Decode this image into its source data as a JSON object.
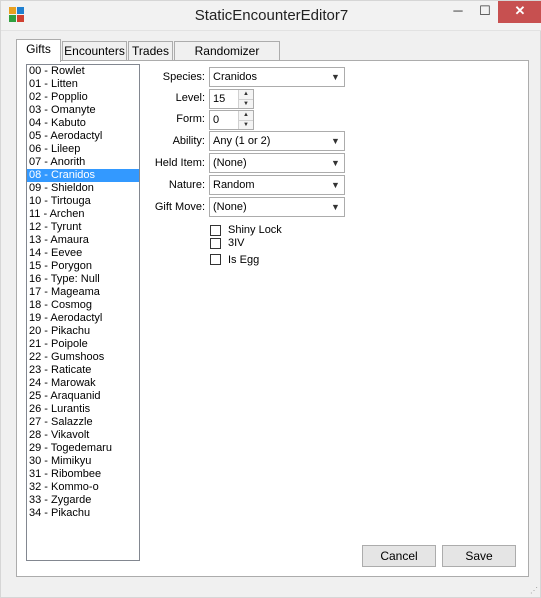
{
  "window": {
    "title": "StaticEncounterEditor7",
    "close_glyph": "✕",
    "min_glyph": "─",
    "max_glyph": "☐"
  },
  "tabs": [
    {
      "label": "Gifts"
    },
    {
      "label": "Encounters"
    },
    {
      "label": "Trades"
    },
    {
      "label": "Randomizer Options"
    }
  ],
  "list": {
    "selected_index": 8,
    "items": [
      "00 - Rowlet",
      "01 - Litten",
      "02 - Popplio",
      "03 - Omanyte",
      "04 - Kabuto",
      "05 - Aerodactyl",
      "06 - Lileep",
      "07 - Anorith",
      "08 - Cranidos",
      "09 - Shieldon",
      "10 - Tirtouga",
      "11 - Archen",
      "12 - Tyrunt",
      "13 - Amaura",
      "14 - Eevee",
      "15 - Porygon",
      "16 - Type: Null",
      "17 - Mageama",
      "18 - Cosmog",
      "19 - Aerodactyl",
      "20 - Pikachu",
      "21 - Poipole",
      "22 - Gumshoos",
      "23 - Raticate",
      "24 - Marowak",
      "25 - Araquanid",
      "26 - Lurantis",
      "27 - Salazzle",
      "28 - Vikavolt",
      "29 - Togedemaru",
      "30 - Mimikyu",
      "31 - Ribombee",
      "32 - Kommo-o",
      "33 - Zygarde",
      "34 - Pikachu"
    ]
  },
  "form": {
    "species": {
      "label": "Species:",
      "value": "Cranidos"
    },
    "level": {
      "label": "Level:",
      "value": "15"
    },
    "form": {
      "label": "Form:",
      "value": "0"
    },
    "ability": {
      "label": "Ability:",
      "value": "Any (1 or 2)"
    },
    "held_item": {
      "label": "Held Item:",
      "value": "(None)"
    },
    "nature": {
      "label": "Nature:",
      "value": "Random"
    },
    "gift_move": {
      "label": "Gift Move:",
      "value": "(None)"
    },
    "checkboxes": [
      {
        "label": "Shiny Lock",
        "checked": false
      },
      {
        "label": "3IV",
        "checked": false
      },
      {
        "label": "Is Egg",
        "checked": false
      }
    ]
  },
  "buttons": {
    "cancel": "Cancel",
    "save": "Save"
  },
  "colors": {
    "selection": "#3399ff",
    "close_button": "#c75050"
  }
}
